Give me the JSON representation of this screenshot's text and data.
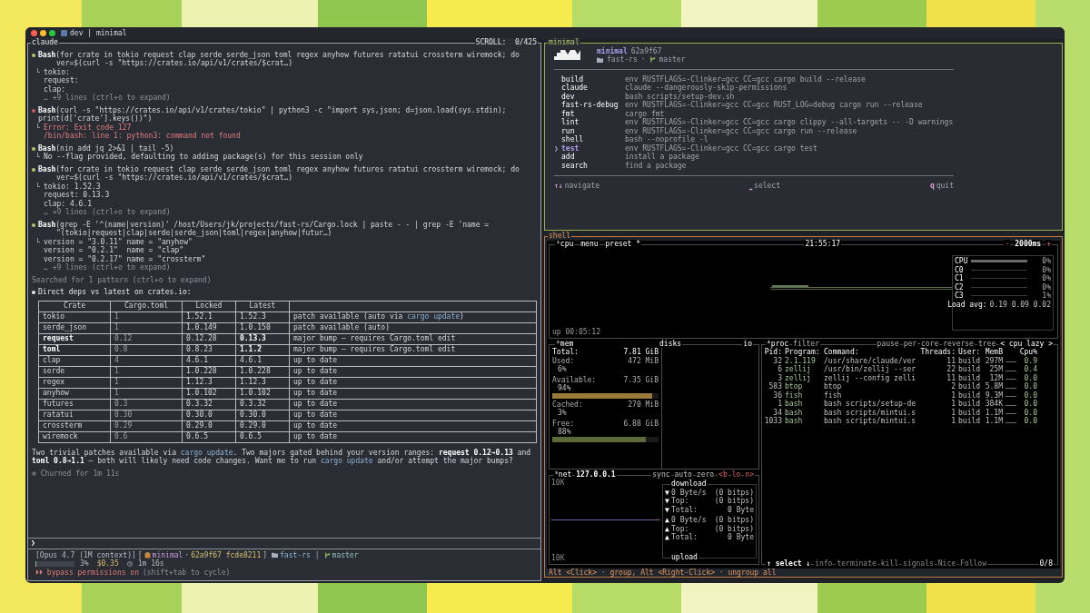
{
  "window": {
    "title": "dev | minimal"
  },
  "claude_pane": {
    "title": "claude",
    "scroll": "SCROLL:  0/425",
    "entries": [
      {
        "kind": "tool",
        "failed": false,
        "name": "Bash",
        "args": [
          "(for crate in tokio request clap serde serde_json toml regex anyhow futures ratatui crossterm wiremock; do",
          "ver=$(curl -s \"https://crates.io/api/v1/crates/$crat…)"
        ],
        "output": [
          {
            "text": "tokio:",
            "kind": "plain"
          },
          {
            "text": "request:",
            "kind": "plain"
          },
          {
            "text": "clap:",
            "kind": "plain"
          },
          {
            "text": "… +9 lines (ctrl+o to expand)",
            "kind": "muted"
          }
        ]
      },
      {
        "kind": "tool",
        "failed": true,
        "name": "Bash",
        "args": [
          "(curl -s \"https://crates.io/api/v1/crates/tokio\" | python3 -c \"import sys,json; d=json.load(sys.stdin); print(d['crate'].keys())\")"
        ],
        "output": [
          {
            "text": "Error: Exit code 127",
            "kind": "error"
          },
          {
            "text": "/bin/bash: line 1: python3: command not found",
            "kind": "error"
          }
        ]
      },
      {
        "kind": "tool",
        "failed": false,
        "name": "Bash",
        "args": [
          "(nin add jq 2>&1 | tail -5)"
        ],
        "output": [
          {
            "text": "No --flag provided, defaulting to adding package(s) for this session only",
            "kind": "plain"
          }
        ]
      },
      {
        "kind": "tool",
        "failed": false,
        "name": "Bash",
        "args": [
          "(for crate in tokio request clap serde serde_json toml regex anyhow futures ratatui crossterm wiremock; do",
          "ver=$(curl -s \"https://crates.io/api/v1/crates/$crat…)"
        ],
        "output": [
          {
            "text": "tokio: 1.52.3",
            "kind": "plain"
          },
          {
            "text": "request: 0.13.3",
            "kind": "plain"
          },
          {
            "text": "clap: 4.6.1",
            "kind": "plain"
          },
          {
            "text": "… +9 lines (ctrl+o to expand)",
            "kind": "muted"
          }
        ]
      },
      {
        "kind": "tool",
        "failed": false,
        "name": "Bash",
        "args": [
          "(grep -E '^(name|version)' /host/Users/jk/projects/fast-rs/Cargo.lock | paste - - | grep -E 'name =",
          "\"(tokio|request|clap|serde|serde_json|toml|regex|anyhow|futur…)"
        ],
        "output": [
          {
            "text": "version = \"3.0.11\" name = \"anyhow\"",
            "kind": "plain"
          },
          {
            "text": "version = \"0.2.1\"  name = \"clap\"",
            "kind": "plain"
          },
          {
            "text": "version = \"0.2.17\" name = \"crossterm\"",
            "kind": "plain"
          },
          {
            "text": "… +9 lines (ctrl+o to expand)",
            "kind": "muted"
          }
        ]
      },
      {
        "kind": "note",
        "text": "Searched for 1 pattern (ctrl+o to expand)"
      },
      {
        "kind": "message",
        "text": "Direct deps vs latest on crates.io:"
      }
    ],
    "table": {
      "columns": [
        "Crate",
        "Cargo.toml",
        "Locked",
        "Latest"
      ],
      "rows": [
        {
          "crate": "tokio",
          "cargo_toml": "1",
          "locked": "1.52.1",
          "latest": "1.52.3",
          "major": false,
          "note": [
            {
              "text": "patch available (auto via ",
              "kind": "plain"
            },
            {
              "text": "cargo update",
              "kind": "code"
            },
            {
              "text": ")",
              "kind": "plain"
            }
          ]
        },
        {
          "crate": "serde_json",
          "cargo_toml": "1",
          "locked": "1.0.149",
          "latest": "1.0.150",
          "major": false,
          "note": [
            {
              "text": "patch available (auto)",
              "kind": "plain"
            }
          ]
        },
        {
          "crate": "request",
          "cargo_toml": "0.12",
          "locked": "0.12.28",
          "latest": "0.13.3",
          "major": true,
          "note": [
            {
              "text": "major bump — requires Cargo.toml edit",
              "kind": "plain"
            }
          ]
        },
        {
          "crate": "toml",
          "cargo_toml": "0.8",
          "locked": "0.8.23",
          "latest": "1.1.2",
          "major": true,
          "note": [
            {
              "text": "major bump — requires Cargo.toml edit",
              "kind": "plain"
            }
          ]
        },
        {
          "crate": "clap",
          "cargo_toml": "4",
          "locked": "4.6.1",
          "latest": "4.6.1",
          "major": false,
          "note": [
            {
              "text": "up to date",
              "kind": "plain"
            }
          ]
        },
        {
          "crate": "serde",
          "cargo_toml": "1",
          "locked": "1.0.228",
          "latest": "1.0.228",
          "major": false,
          "note": [
            {
              "text": "up to date",
              "kind": "plain"
            }
          ]
        },
        {
          "crate": "regex",
          "cargo_toml": "1",
          "locked": "1.12.3",
          "latest": "1.12.3",
          "major": false,
          "note": [
            {
              "text": "up to date",
              "kind": "plain"
            }
          ]
        },
        {
          "crate": "anyhow",
          "cargo_toml": "1",
          "locked": "1.0.102",
          "latest": "1.0.102",
          "major": false,
          "note": [
            {
              "text": "up to date",
              "kind": "plain"
            }
          ]
        },
        {
          "crate": "futures",
          "cargo_toml": "0.3",
          "locked": "0.3.32",
          "latest": "0.3.32",
          "major": false,
          "note": [
            {
              "text": "up to date",
              "kind": "plain"
            }
          ]
        },
        {
          "crate": "ratatui",
          "cargo_toml": "0.30",
          "locked": "0.30.0",
          "latest": "0.30.0",
          "major": false,
          "note": [
            {
              "text": "up to date",
              "kind": "plain"
            }
          ]
        },
        {
          "crate": "crossterm",
          "cargo_toml": "0.29",
          "locked": "0.29.0",
          "latest": "0.29.0",
          "major": false,
          "note": [
            {
              "text": "up to date",
              "kind": "plain"
            }
          ]
        },
        {
          "crate": "wiremock",
          "cargo_toml": "0.6",
          "locked": "0.6.5",
          "latest": "0.6.5",
          "major": false,
          "note": [
            {
              "text": "up to date",
              "kind": "plain"
            }
          ]
        }
      ]
    },
    "summary": [
      {
        "text": "Two trivial patches available via ",
        "kind": "plain"
      },
      {
        "text": "cargo update",
        "kind": "code"
      },
      {
        "text": ". Two majors gated behind your version ranges: ",
        "kind": "plain"
      },
      {
        "text": "request 0.12→0.13",
        "kind": "bold"
      },
      {
        "text": " and ",
        "kind": "plain"
      },
      {
        "text": "toml 0.8→1.1",
        "kind": "bold"
      },
      {
        "text": " – both will likely need code changes. Want me to run ",
        "kind": "plain"
      },
      {
        "text": "cargo update",
        "kind": "code"
      },
      {
        "text": " and/or attempt the major bumps?",
        "kind": "plain"
      }
    ],
    "churned": "✻ Churned for 1m 11s",
    "prompt": "❯",
    "status": {
      "model": "[Opus 4.7 (1M context)]",
      "open": "[",
      "session": "minimal",
      "dot": "·",
      "commits": "62a9f67 fcde8211",
      "close": "]",
      "directory": "fast-rs",
      "separator": "│",
      "branch": "master",
      "context": {
        "level": 0.03,
        "percent": "3%"
      },
      "cost": "$0.35",
      "duration": "1m 16s",
      "mode_arrows": "⏵⏵",
      "mode": "bypass permissions on",
      "mode_hint": "(shift+tab to cycle)"
    }
  },
  "minimal_pane": {
    "title": "minimal",
    "app": "minimal",
    "commit": "62a9f67",
    "directory": "fast-rs",
    "dot": "·",
    "branch": "master",
    "pointer": "❯",
    "commands": [
      {
        "name": "build",
        "command": "env RUSTFLAGS=-Clinker=gcc CC=gcc cargo build --release",
        "selected": false
      },
      {
        "name": "claude",
        "command": "claude --dangerously-skip-permissions",
        "selected": false
      },
      {
        "name": "dev",
        "command": "bash scripts/setup-dev.sh",
        "selected": false
      },
      {
        "name": "fast-rs-debug",
        "command": "env RUSTFLAGS=-Clinker=gcc CC=gcc RUST_LOG=debug cargo run --release",
        "selected": false
      },
      {
        "name": "fmt",
        "command": "cargo fmt",
        "selected": false
      },
      {
        "name": "lint",
        "command": "env RUSTFLAGS=-Clinker=gcc CC=gcc cargo clippy --all-targets -- -D warnings",
        "selected": false
      },
      {
        "name": "run",
        "command": "env RUSTFLAGS=-Clinker=gcc CC=gcc cargo run --release",
        "selected": false
      },
      {
        "name": "shell",
        "command": "bash --noprofile -l",
        "selected": false
      },
      {
        "name": "test",
        "command": "env RUSTFLAGS=-Clinker=gcc CC=gcc cargo test",
        "selected": true
      },
      {
        "name": "add",
        "command": "install a package",
        "selected": false
      },
      {
        "name": "search",
        "command": "find a package",
        "selected": false
      }
    ],
    "hints": [
      {
        "key": "↑↓",
        "label": "navigate"
      },
      {
        "key": "⎵",
        "label": "select"
      },
      {
        "key": "q",
        "label": "quit"
      }
    ]
  },
  "shell_pane": {
    "title": "shell",
    "cpu": {
      "tabs": [
        "¹cpu",
        "menu",
        "preset *"
      ],
      "clock": "21:55:17",
      "minus": "-",
      "interval": "2000ms",
      "plus": "+",
      "uptime": "up 00:05:12",
      "meters": [
        {
          "name": "CPU",
          "reading": "0%"
        },
        {
          "name": "C0",
          "reading": "0%"
        },
        {
          "name": "C1",
          "reading": "0%"
        },
        {
          "name": "C2",
          "reading": "0%"
        },
        {
          "name": "C3",
          "reading": "1%"
        }
      ],
      "load_label": "Load avg:",
      "load": "0.19 0.09 0.02"
    },
    "mem": {
      "title": "²mem",
      "disks_title": "disks",
      "io_title": "io",
      "rows": [
        {
          "label": "Total:",
          "value": "7.81 GiB"
        },
        {
          "label": "Used:",
          "value": "472 MiB",
          "percent": "6%"
        },
        {
          "label": "Available:",
          "value": "7.35 GiB",
          "percent": "94%",
          "level": 0.94,
          "color": "#9a7a3a"
        },
        {
          "label": "Cached:",
          "value": "270 MiB",
          "percent": "3%"
        },
        {
          "label": "Free:",
          "value": "6.88 GiB",
          "percent": "88%",
          "level": 0.88,
          "color": "#5c6a3a"
        }
      ]
    },
    "net": {
      "title": "³net",
      "interface": "127.0.0.1",
      "options": [
        "sync",
        "auto",
        "zero",
        "<b",
        "lo",
        "n>"
      ],
      "scale_top": "10K",
      "scale_bottom": "10K",
      "download": "download",
      "upload": "upload",
      "stats": [
        {
          "arrow": "▼",
          "label": "0 Byte/s",
          "value": "(0 bitps)"
        },
        {
          "arrow": "▼",
          "label": "Top:",
          "value": "(0 bitps)"
        },
        {
          "arrow": "▼",
          "label": "Total:",
          "value": "0 Byte"
        },
        {
          "arrow": "▲",
          "label": "0 Byte/s",
          "value": "(0 bitps)"
        },
        {
          "arrow": "▲",
          "label": "Top:",
          "value": "(0 bitps)"
        },
        {
          "arrow": "▲",
          "label": "Total:",
          "value": "0 Byte"
        }
      ]
    },
    "proc": {
      "title": "⁴proc",
      "options": [
        "filter",
        "pause",
        "per-core",
        "reverse",
        "tree",
        "< cpu lazy >"
      ],
      "columns": [
        "Pid:",
        "Program:",
        "Command:",
        "Threads:",
        "User:",
        "MemB",
        "Cpu%"
      ],
      "rows": [
        {
          "pid": "32",
          "program": "2.1.119",
          "command": "/usr/share/claude/ver",
          "threads": "11",
          "user": "build",
          "mem": "297M",
          "cpu": "0.9"
        },
        {
          "pid": "6",
          "program": "zellij",
          "command": "/usr/bin/zellij --ser",
          "threads": "22",
          "user": "build",
          "mem": "25M",
          "cpu": "0.4"
        },
        {
          "pid": "3",
          "program": "zellij",
          "command": "zellij --config zelli",
          "threads": "11",
          "user": "build",
          "mem": "12M",
          "cpu": "0.0"
        },
        {
          "pid": "583",
          "program": "btop",
          "command": "btop",
          "threads": "2",
          "user": "build",
          "mem": "5.8M",
          "cpu": "0.0"
        },
        {
          "pid": "36",
          "program": "fish",
          "command": "fish",
          "threads": "1",
          "user": "build",
          "mem": "9.3M",
          "cpu": "0.0"
        },
        {
          "pid": "1",
          "program": "bash",
          "command": "bash scripts/setup-de",
          "threads": "1",
          "user": "build",
          "mem": "384K",
          "cpu": "0.0"
        },
        {
          "pid": "34",
          "program": "bash",
          "command": "bash scripts/mintui.s",
          "threads": "1",
          "user": "build",
          "mem": "1.1M",
          "cpu": "0.0"
        },
        {
          "pid": "1033",
          "program": "bash",
          "command": "bash scripts/mintui.s",
          "threads": "1",
          "user": "build",
          "mem": "1.1M",
          "cpu": "0.0"
        }
      ],
      "footer": [
        "↑ select ↓",
        "info",
        "terminate",
        "kill",
        "signals",
        "Nice",
        "Follow"
      ],
      "count": "0/8"
    },
    "hint": "Alt <Click> · group, Alt <Right-Click> · ungroup all"
  }
}
